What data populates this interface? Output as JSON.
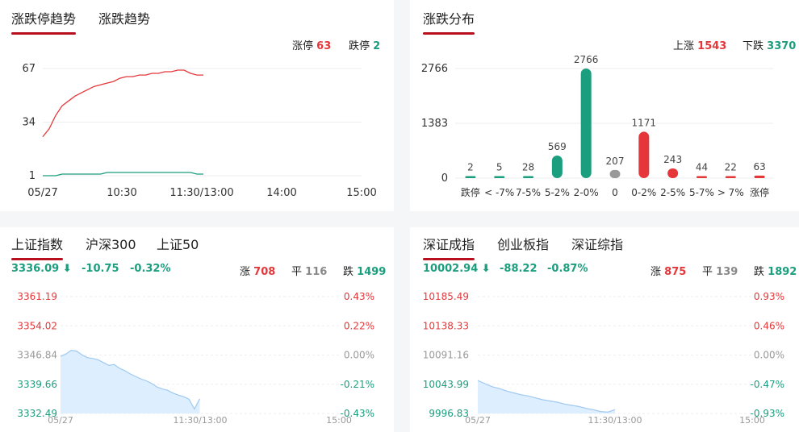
{
  "colors": {
    "up": "#e5373a",
    "down": "#1a9e7e",
    "flat": "#999999",
    "accent": "#b8101f",
    "area": "#ddeeff",
    "line": "#9fc9f1"
  },
  "trend_panel": {
    "tabs": [
      "涨跌停趋势",
      "涨跌趋势"
    ],
    "limit_up_label": "涨停",
    "limit_up_value": "63",
    "limit_down_label": "跌停",
    "limit_down_value": "2",
    "y_ticks": [
      "67",
      "34",
      "1"
    ],
    "x_ticks": [
      "05/27",
      "10:30",
      "11:30/13:00",
      "14:00",
      "15:00"
    ]
  },
  "dist_panel": {
    "title": "涨跌分布",
    "up_label": "上涨",
    "up_value": "1543",
    "down_label": "下跌",
    "down_value": "3370",
    "y_ticks": [
      "2766",
      "1383",
      "0"
    ]
  },
  "sh_panel": {
    "tabs": [
      "上证指数",
      "沪深300",
      "上证50"
    ],
    "price": "3336.09",
    "change": "-10.75",
    "change_pct": "-0.32%",
    "up_label": "涨",
    "up_count": "708",
    "flat_label": "平",
    "flat_count": "116",
    "down_label": "跌",
    "down_count": "1499",
    "left_ticks": [
      "3361.19",
      "3354.02",
      "3346.84",
      "3339.66",
      "3332.49"
    ],
    "right_ticks": [
      "0.43%",
      "0.22%",
      "0.00%",
      "-0.21%",
      "-0.43%"
    ],
    "x_ticks": [
      "05/27",
      "11:30/13:00",
      "15:00"
    ]
  },
  "sz_panel": {
    "tabs": [
      "深证成指",
      "创业板指",
      "深证综指"
    ],
    "price": "10002.94",
    "change": "-88.22",
    "change_pct": "-0.87%",
    "up_label": "涨",
    "up_count": "875",
    "flat_label": "平",
    "flat_count": "139",
    "down_label": "跌",
    "down_count": "1892",
    "left_ticks": [
      "10185.49",
      "10138.33",
      "10091.16",
      "10043.99",
      "9996.83"
    ],
    "right_ticks": [
      "0.93%",
      "0.46%",
      "0.00%",
      "-0.47%",
      "-0.93%"
    ],
    "x_ticks": [
      "05/27",
      "11:30/13:00",
      "15:00"
    ]
  },
  "chart_data": [
    {
      "type": "line",
      "x_range": [
        "09:30",
        "15:00"
      ],
      "ylim": [
        1,
        67
      ],
      "series": [
        {
          "name": "涨停",
          "values": [
            25,
            30,
            38,
            44,
            47,
            50,
            52,
            54,
            56,
            57,
            58,
            59,
            61,
            62,
            62,
            63,
            63,
            64,
            64,
            65,
            65,
            66,
            66,
            64,
            63,
            63
          ]
        },
        {
          "name": "跌停",
          "values": [
            1,
            1,
            1,
            2,
            2,
            2,
            2,
            2,
            2,
            2,
            3,
            3,
            3,
            3,
            3,
            3,
            3,
            3,
            3,
            3,
            3,
            3,
            3,
            3,
            2,
            2
          ]
        }
      ]
    },
    {
      "type": "bar",
      "categories": [
        "跌停",
        "< -7%",
        "7-5%",
        "5-2%",
        "2-0%",
        "0",
        "0-2%",
        "2-5%",
        "5-7%",
        "> 7%",
        "涨停"
      ],
      "values": [
        2,
        5,
        28,
        569,
        2766,
        207,
        1171,
        243,
        44,
        22,
        63
      ],
      "ylim": [
        0,
        2766
      ]
    },
    {
      "type": "area",
      "name": "上证指数",
      "ylim": [
        3332.49,
        3361.19
      ],
      "values": [
        3346.5,
        3347.1,
        3348.0,
        3347.8,
        3346.9,
        3346.2,
        3346.0,
        3345.7,
        3345.0,
        3344.3,
        3344.5,
        3343.6,
        3343.0,
        3342.2,
        3341.6,
        3341.0,
        3340.5,
        3339.9,
        3339.0,
        3338.5,
        3338.2,
        3337.5,
        3337.0,
        3336.6,
        3336.0,
        3333.6,
        3336.09
      ]
    },
    {
      "type": "area",
      "name": "深证成指",
      "ylim": [
        9996.83,
        10185.49
      ],
      "values": [
        10050.0,
        10045.0,
        10040.0,
        10037.0,
        10033.0,
        10030.0,
        10027.0,
        10025.0,
        10022.0,
        10019.0,
        10017.0,
        10015.0,
        10012.0,
        10010.0,
        10008.0,
        10005.0,
        10003.0,
        10000.0,
        9999.0,
        10002.94
      ]
    }
  ]
}
